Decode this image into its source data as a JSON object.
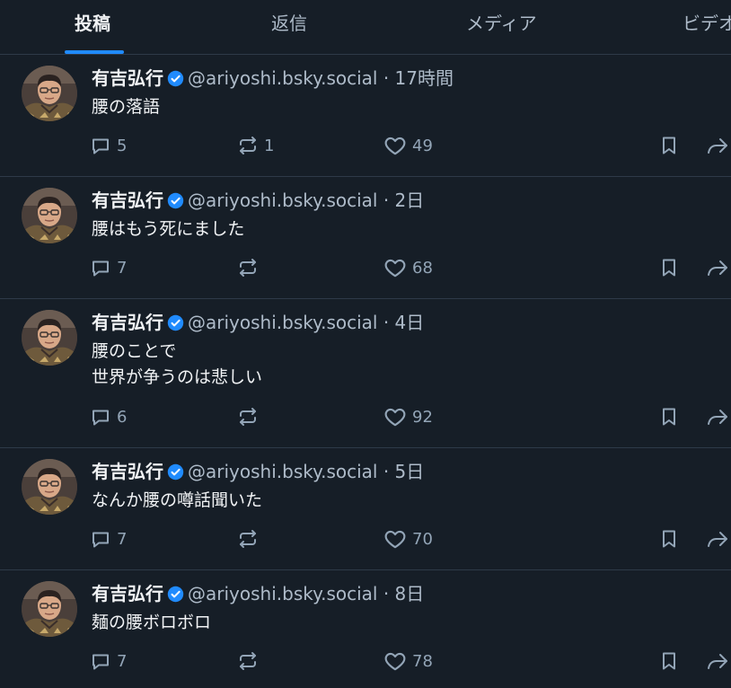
{
  "tabs": [
    {
      "label": "投稿",
      "active": true
    },
    {
      "label": "返信",
      "active": false
    },
    {
      "label": "メディア",
      "active": false
    },
    {
      "label": "ビデオ",
      "active": false
    }
  ],
  "colors": {
    "background": "#161e27",
    "accent": "#208bfe",
    "divider": "#2e3a48",
    "text": "#f1f3f5",
    "muted": "#aebbc9"
  },
  "icons": [
    "verified-badge-icon",
    "reply-icon",
    "repost-icon",
    "like-icon",
    "bookmark-icon",
    "share-icon"
  ],
  "posts": [
    {
      "author": "有吉弘行",
      "handle": "@ariyoshi.bsky.social",
      "time": "17時間",
      "text": "腰の落語",
      "replies": "5",
      "reposts": "1",
      "likes": "49"
    },
    {
      "author": "有吉弘行",
      "handle": "@ariyoshi.bsky.social",
      "time": "2日",
      "text": "腰はもう死にました",
      "replies": "7",
      "reposts": "",
      "likes": "68"
    },
    {
      "author": "有吉弘行",
      "handle": "@ariyoshi.bsky.social",
      "time": "4日",
      "text": "腰のことで\n世界が争うのは悲しい",
      "replies": "6",
      "reposts": "",
      "likes": "92"
    },
    {
      "author": "有吉弘行",
      "handle": "@ariyoshi.bsky.social",
      "time": "5日",
      "text": "なんか腰の噂話聞いた",
      "replies": "7",
      "reposts": "",
      "likes": "70"
    },
    {
      "author": "有吉弘行",
      "handle": "@ariyoshi.bsky.social",
      "time": "8日",
      "text": "麺の腰ボロボロ",
      "replies": "7",
      "reposts": "",
      "likes": "78"
    }
  ]
}
